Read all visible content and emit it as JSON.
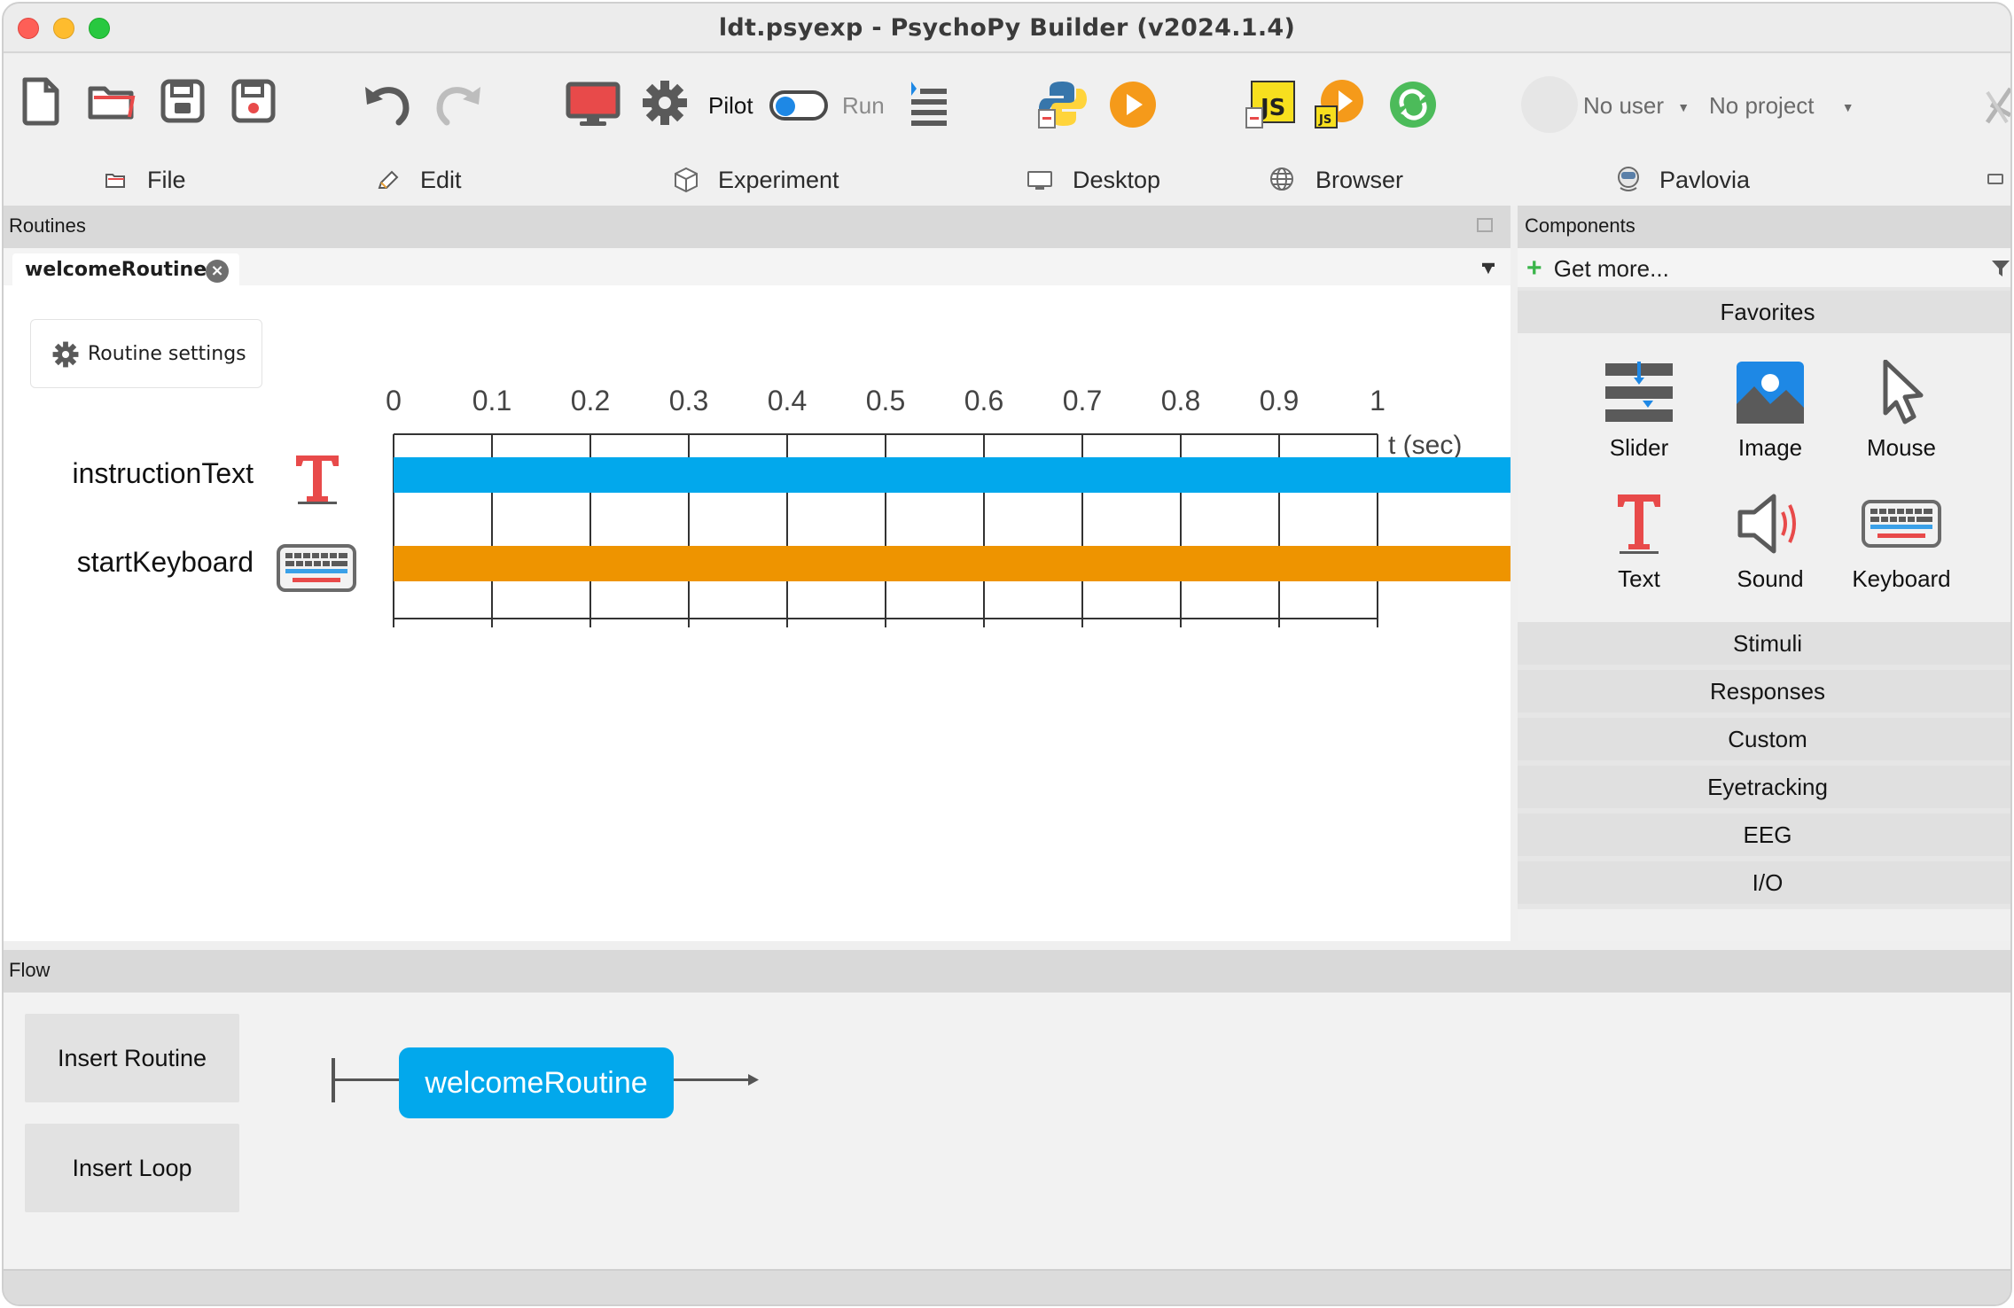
{
  "window": {
    "title": "ldt.psyexp - PsychoPy Builder (v2024.1.4)"
  },
  "toolbar": {
    "pilot_label": "Pilot",
    "run_label": "Run",
    "user_label": "No user",
    "project_label": "No project",
    "sections": [
      {
        "label": "File",
        "icon": "folder-icon"
      },
      {
        "label": "Edit",
        "icon": "pencil-icon"
      },
      {
        "label": "Experiment",
        "icon": "cube-icon"
      },
      {
        "label": "Desktop",
        "icon": "monitor-icon"
      },
      {
        "label": "Browser",
        "icon": "globe-icon"
      },
      {
        "label": "Pavlovia",
        "icon": "pavlovia-icon"
      }
    ]
  },
  "routines": {
    "header": "Routines",
    "active_tab": "welcomeRoutine",
    "settings_label": "Routine settings",
    "timeline": {
      "ticks": [
        "0",
        "0.1",
        "0.2",
        "0.3",
        "0.4",
        "0.5",
        "0.6",
        "0.7",
        "0.8",
        "0.9",
        "1"
      ],
      "unit_label": "t (sec)"
    },
    "components": [
      {
        "name": "instructionText",
        "type": "text",
        "color": "#02a8ec"
      },
      {
        "name": "startKeyboard",
        "type": "keyboard",
        "color": "#ee9400"
      }
    ]
  },
  "components_panel": {
    "header": "Components",
    "get_more": "Get more...",
    "favorites_label": "Favorites",
    "favorites": [
      {
        "label": "Slider",
        "icon": "slider-icon"
      },
      {
        "label": "Image",
        "icon": "image-icon"
      },
      {
        "label": "Mouse",
        "icon": "mouse-icon"
      },
      {
        "label": "Text",
        "icon": "text-icon"
      },
      {
        "label": "Sound",
        "icon": "sound-icon"
      },
      {
        "label": "Keyboard",
        "icon": "keyboard-icon"
      }
    ],
    "categories": [
      "Stimuli",
      "Responses",
      "Custom",
      "Eyetracking",
      "EEG",
      "I/O"
    ]
  },
  "flow": {
    "header": "Flow",
    "insert_routine": "Insert Routine",
    "insert_loop": "Insert Loop",
    "routine": "welcomeRoutine"
  },
  "colors": {
    "accent_blue": "#02a8ec",
    "accent_orange": "#ee9400",
    "text_red": "#e04646"
  }
}
